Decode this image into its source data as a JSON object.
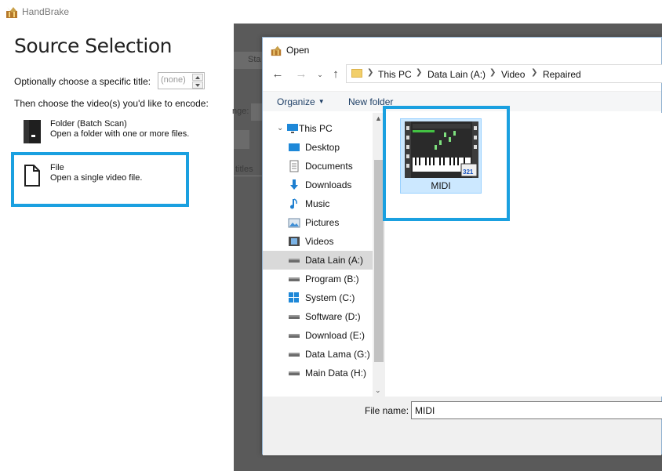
{
  "app": {
    "title": "HandBrake"
  },
  "source_selection": {
    "heading": "Source Selection",
    "title_prompt": "Optionally choose a specific title:",
    "title_value": "(none)",
    "choose_prompt": "Then choose the video(s) you'd like to encode:",
    "options": [
      {
        "title": "Folder (Batch Scan)",
        "description": "Open a folder with one or more files.",
        "icon": "folder-batch-icon"
      },
      {
        "title": "File",
        "description": "Open a single video file.",
        "icon": "file-icon"
      }
    ]
  },
  "background_fragments": {
    "start_label": "Sta",
    "range_label": "nge:",
    "subtitles_label": "titles"
  },
  "dialog": {
    "title": "Open",
    "breadcrumb": [
      "This PC",
      "Data Lain (A:)",
      "Video",
      "Repaired"
    ],
    "toolbar": {
      "organize": "Organize",
      "new_folder": "New folder"
    },
    "nav_items": [
      {
        "label": "This PC",
        "icon": "this-pc-icon",
        "root": true
      },
      {
        "label": "Desktop",
        "icon": "desktop-icon"
      },
      {
        "label": "Documents",
        "icon": "documents-icon"
      },
      {
        "label": "Downloads",
        "icon": "downloads-icon"
      },
      {
        "label": "Music",
        "icon": "music-icon"
      },
      {
        "label": "Pictures",
        "icon": "pictures-icon"
      },
      {
        "label": "Videos",
        "icon": "videos-icon"
      },
      {
        "label": "Data Lain (A:)",
        "icon": "drive-icon",
        "selected": true
      },
      {
        "label": "Program (B:)",
        "icon": "drive-icon"
      },
      {
        "label": "System (C:)",
        "icon": "system-drive-icon"
      },
      {
        "label": "Software (D:)",
        "icon": "drive-icon"
      },
      {
        "label": "Download (E:)",
        "icon": "drive-icon"
      },
      {
        "label": "Data Lama (G:)",
        "icon": "drive-icon"
      },
      {
        "label": "Main Data (H:)",
        "icon": "drive-icon"
      }
    ],
    "files": [
      {
        "name": "MIDI",
        "selected": true
      }
    ],
    "file_name_label": "File name:",
    "file_name_value": "MIDI"
  },
  "colors": {
    "highlight": "#1aa0e0",
    "selection": "#cce8ff",
    "dim": "#5a5a5a"
  }
}
